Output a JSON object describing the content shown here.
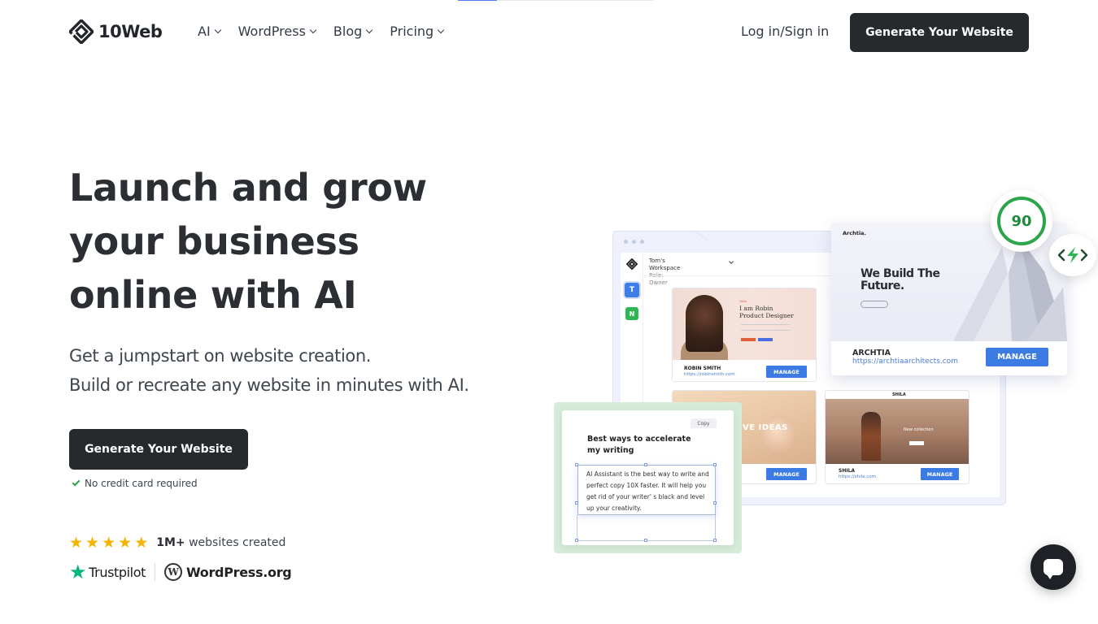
{
  "progress_value": 0.2,
  "header": {
    "logo_text": "10Web",
    "nav": [
      {
        "label": "AI"
      },
      {
        "label": "WordPress"
      },
      {
        "label": "Blog"
      },
      {
        "label": "Pricing"
      }
    ],
    "login_label": "Log in/Sign in",
    "cta_label": "Generate Your Website"
  },
  "hero": {
    "title_line1": "Launch and grow",
    "title_line2": "your business",
    "title_line3": "online with AI",
    "subtitle_line1": "Get a jumpstart on website creation.",
    "subtitle_line2": "Build or recreate any website in minutes with AI.",
    "cta_label": "Generate Your Website",
    "no_cc": "No credit card required",
    "stars": 5,
    "rating_bold": "1M+",
    "rating_text": " websites created",
    "trustpilot": "Trustpilot",
    "wordpress": "WordPress.org"
  },
  "illustration": {
    "workspace_name": "Tom's Workspace",
    "workspace_role": "Role: Owner",
    "side_t": "T",
    "side_n": "N",
    "robin": {
      "hello": "Hello",
      "title_line1": "I am Robin",
      "title_line2": "Product Designer",
      "name": "ROBIN SMITH",
      "url": "https://robinsmith.com",
      "manage": "MANAGE"
    },
    "ideas": {
      "overlay": "VE IDEAS",
      "manage": "MANAGE"
    },
    "shila": {
      "brand": "SHILA",
      "collection": "New collection",
      "name": "SHILA",
      "url": "https://shila.com",
      "manage": "MANAGE"
    },
    "archtia": {
      "logo": "Archtia.",
      "headline_line1": "We Build The",
      "headline_line2": "Future.",
      "name": "ARCHTIA",
      "url": "https://archtiaarchitects.com",
      "manage": "MANAGE"
    },
    "score": "90",
    "ai_card": {
      "copy_label": "Copy",
      "title": "Best ways to accelerate my writing",
      "body": "AI Assistant is the best way to write and perfect copy 10X faster. It will help you get rid of your writer' s black and level up your creativity."
    }
  },
  "colors": {
    "primary_dark": "#272a2d",
    "accent_blue": "#3b7be3",
    "success_green": "#2aa54a",
    "star_yellow": "#f4b400",
    "trustpilot_green": "#00b67a"
  }
}
